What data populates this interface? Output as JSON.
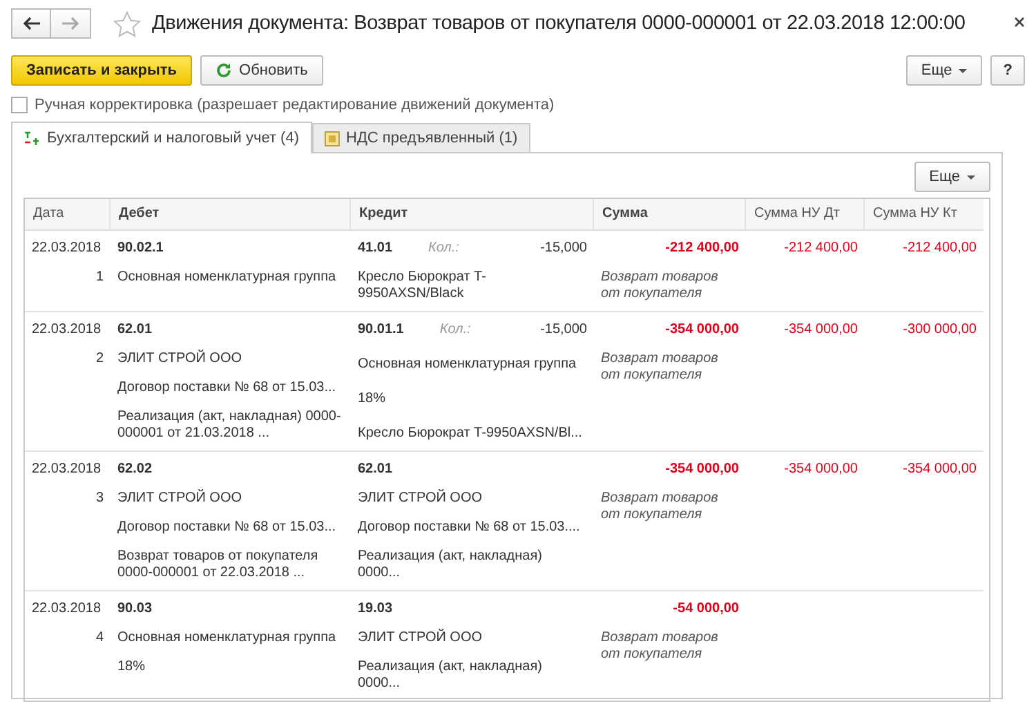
{
  "window": {
    "title": "Движения документа: Возврат товаров от покупателя 0000-000001 от 22.03.2018 12:00:00"
  },
  "toolbar": {
    "save_close": "Записать и закрыть",
    "refresh": "Обновить",
    "more": "Еще",
    "help": "?"
  },
  "manual_edit": {
    "label": "Ручная корректировка (разрешает редактирование движений документа)",
    "checked": false
  },
  "tabs": [
    {
      "label": "Бухгалтерский и налоговый учет (4)",
      "selected": true,
      "kind": "dtkt"
    },
    {
      "label": "НДС предъявленный (1)",
      "selected": false,
      "kind": "register"
    }
  ],
  "table": {
    "more": "Еще",
    "columns": [
      "Дата",
      "Дебет",
      "Кредит",
      "Сумма",
      "Сумма НУ Дт",
      "Сумма НУ Кт"
    ],
    "rows": [
      {
        "date": "22.03.2018",
        "number": "1",
        "debit": [
          "90.02.1",
          "Основная номенклатурная группа"
        ],
        "credit": [
          "41.01",
          "Кресло Бюрократ T-9950AXSN/Black"
        ],
        "qty_label": "Кол.:",
        "qty": "-15,000",
        "sum": "-212 400,00",
        "content": "Возврат товаров от покупателя",
        "sum_nu_dt": "-212 400,00",
        "sum_nu_kt": "-212 400,00"
      },
      {
        "date": "22.03.2018",
        "number": "2",
        "debit": [
          "62.01",
          "ЭЛИТ СТРОЙ ООО",
          "Договор поставки № 68 от 15.03...",
          "Реализация (акт, накладная) 0000-000001 от 21.03.2018 ..."
        ],
        "credit": [
          "90.01.1",
          "Основная номенклатурная группа",
          "18%",
          "Кресло Бюрократ T-9950AXSN/Bl..."
        ],
        "qty_label": "Кол.:",
        "qty": "-15,000",
        "sum": "-354 000,00",
        "content": "Возврат товаров от покупателя",
        "sum_nu_dt": "-354 000,00",
        "sum_nu_kt": "-300 000,00"
      },
      {
        "date": "22.03.2018",
        "number": "3",
        "debit": [
          "62.02",
          "ЭЛИТ СТРОЙ ООО",
          "Договор поставки № 68 от 15.03...",
          "Возврат товаров от покупателя 0000-000001 от 22.03.2018 ..."
        ],
        "credit": [
          "62.01",
          "ЭЛИТ СТРОЙ ООО",
          "Договор поставки № 68 от 15.03....",
          "Реализация (акт, накладная) 0000..."
        ],
        "sum": "-354 000,00",
        "content": "Возврат товаров от покупателя",
        "sum_nu_dt": "-354 000,00",
        "sum_nu_kt": "-354 000,00"
      },
      {
        "date": "22.03.2018",
        "number": "4",
        "debit": [
          "90.03",
          "Основная номенклатурная группа",
          "18%"
        ],
        "credit": [
          "19.03",
          "ЭЛИТ СТРОЙ ООО",
          "Реализация (акт, накладная) 0000..."
        ],
        "sum": "-54 000,00",
        "content": "Возврат товаров от покупателя"
      }
    ]
  }
}
